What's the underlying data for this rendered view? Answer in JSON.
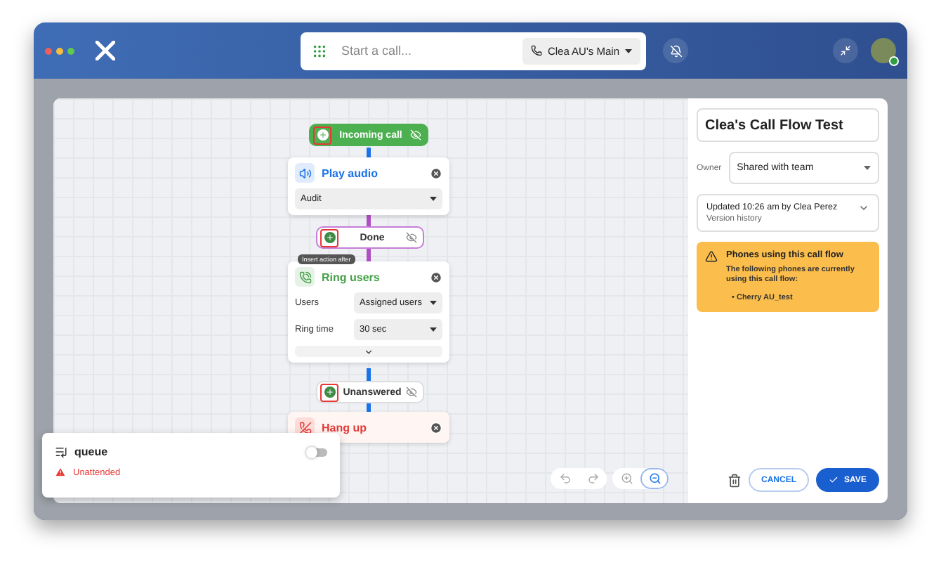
{
  "topbar": {
    "search": {
      "placeholder": "Start a call..."
    },
    "line": "Clea AU's Main"
  },
  "flow": {
    "nodes": [
      {
        "kind": "pill",
        "label": "Incoming call",
        "color": "#4caf50",
        "marked": true
      },
      {
        "kind": "audio",
        "title": "Play audio",
        "color": "#1a73e8",
        "fields": [
          {
            "value": "Audit"
          }
        ]
      },
      {
        "kind": "pill",
        "label": "Done",
        "color": "#c77dd6",
        "marked": true
      },
      {
        "kind": "ring",
        "title": "Ring users",
        "color": "#43a047",
        "fields": [
          {
            "label": "Users",
            "value": "Assigned users"
          },
          {
            "label": "Ring time",
            "value": "30 sec"
          }
        ],
        "expandable": true
      },
      {
        "kind": "pill",
        "label": "Unanswered",
        "color": "#dddddd",
        "marked": true
      },
      {
        "kind": "hangup",
        "title": "Hang up",
        "color": "#e53935"
      }
    ],
    "tooltip": "Insert action after"
  },
  "panel": {
    "title": "Clea's Call Flow Test",
    "owner_label": "Owner",
    "owner": "Shared with team",
    "updated": "Updated 10:26 am by Clea Perez",
    "history": "Version history",
    "alert": {
      "title": "Phones using this call flow",
      "body": "The following phones are currently using this call flow:",
      "bullet": "•",
      "phones": [
        "Cherry AU_test"
      ]
    },
    "cancel": "CANCEL",
    "save": "SAVE"
  },
  "queue": {
    "name": "queue",
    "on": false,
    "status": "Unattended"
  }
}
